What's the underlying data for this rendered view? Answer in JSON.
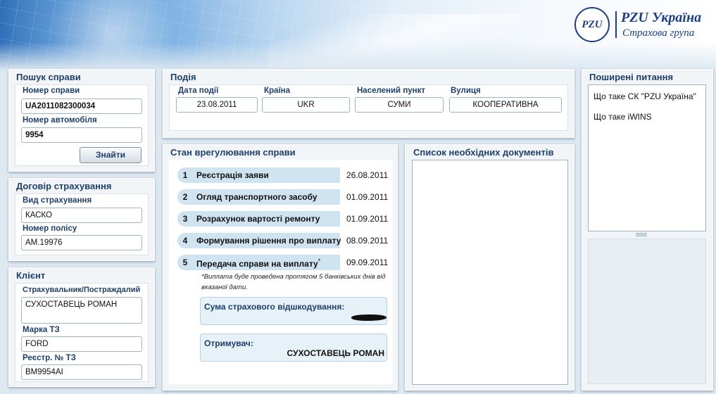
{
  "brand": {
    "emblem": "PZU",
    "title": "PZU Україна",
    "subtitle": "Страхова група"
  },
  "search": {
    "title": "Пошук справи",
    "case_label": "Номер справи",
    "case_value": "UA2011082300034",
    "car_label": "Номер автомобіля",
    "car_value": "9954",
    "find_button": "Знайти"
  },
  "contract": {
    "title": "Договір страхування",
    "type_label": "Вид страхування",
    "type_value": "КАСКО",
    "policy_label": "Номер полісу",
    "policy_value": "АМ.19976"
  },
  "client": {
    "title": "Клієнт",
    "insured_label": "Страхувальник/Постраждалий",
    "insured_value": "СУХОСТАВЕЦЬ РОМАН",
    "brand_label": "Марка ТЗ",
    "brand_value": "FORD",
    "reg_label": "Реєстр. № ТЗ",
    "reg_value": "ВМ9954АІ"
  },
  "event": {
    "title": "Подія",
    "date_label": "Дата події",
    "date_value": "23.08.2011",
    "country_label": "Країна",
    "country_value": "UKR",
    "city_label": "Населений пункт",
    "city_value": "СУМИ",
    "street_label": "Вулиця",
    "street_value": "КООПЕРАТИВНА"
  },
  "status": {
    "title": "Стан врегулювання справи",
    "steps": [
      {
        "num": "1",
        "name": "Реєстрація заяви",
        "date": "26.08.2011"
      },
      {
        "num": "2",
        "name": "Огляд транспортного засобу",
        "date": "01.09.2011"
      },
      {
        "num": "3",
        "name": "Розрахунок вартості ремонту",
        "date": "01.09.2011"
      },
      {
        "num": "4",
        "name": "Формування рішення про виплату",
        "date": "08.09.2011"
      },
      {
        "num": "5",
        "name": "Передача справи на виплату",
        "date": "09.09.2011"
      }
    ],
    "asterisk": "*",
    "note": "*Виплата буде проведена протягом 5 банківських днів від вказаної дати.",
    "compensation_label": "Сума страхового відшкодування:",
    "recipient_label": "Отримувач:",
    "recipient_value": "СУХОСТАВЕЦЬ РОМАН"
  },
  "documents": {
    "title": "Список необхідних документів"
  },
  "faq": {
    "title": "Поширені питання",
    "items": [
      "Що таке СК \"PZU Україна\"",
      "Що таке iWINS"
    ]
  }
}
